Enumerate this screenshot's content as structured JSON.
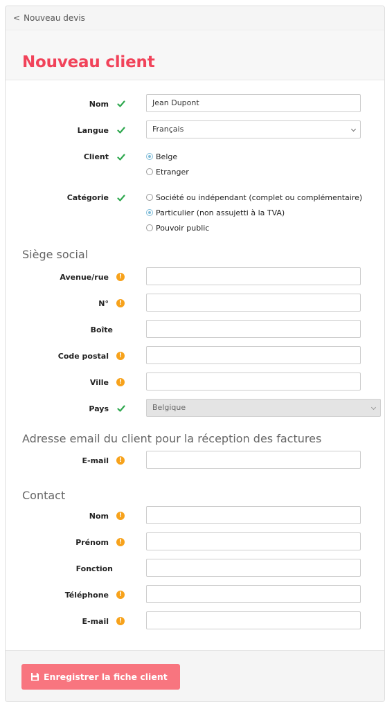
{
  "breadcrumb": {
    "icon": "chevron-left-icon",
    "label": "Nouveau devis"
  },
  "page_title": "Nouveau client",
  "colors": {
    "title": "#f1435a",
    "ok": "#2fa84f",
    "warn": "#f7a21b",
    "save_button": "#f8757f",
    "radio_selected": "#7fbcd8"
  },
  "client": {
    "nom": {
      "label": "Nom",
      "status": "check-icon",
      "value": "Jean Dupont"
    },
    "langue": {
      "label": "Langue",
      "status": "check-icon",
      "value": "Français"
    },
    "type": {
      "label": "Client",
      "status": "check-icon",
      "options": [
        "Belge",
        "Etranger"
      ],
      "selected": "Belge"
    },
    "categorie": {
      "label": "Catégorie",
      "status": "check-icon",
      "options": [
        "Société ou indépendant (complet ou complémentaire)",
        "Particulier (non assujetti à la TVA)",
        "Pouvoir public"
      ],
      "selected": "Particulier (non assujetti à la TVA)"
    }
  },
  "siege": {
    "title": "Siège social",
    "fields": {
      "avenue": {
        "label": "Avenue/rue",
        "status": "warning-icon",
        "value": ""
      },
      "numero": {
        "label": "N°",
        "status": "warning-icon",
        "value": ""
      },
      "boite": {
        "label": "Boîte",
        "value": ""
      },
      "code_postal": {
        "label": "Code postal",
        "status": "warning-icon",
        "value": ""
      },
      "ville": {
        "label": "Ville",
        "status": "warning-icon",
        "value": ""
      },
      "pays": {
        "label": "Pays",
        "status": "check-icon",
        "value": "Belgique"
      }
    }
  },
  "facturation": {
    "title": "Adresse email du client pour la réception des factures",
    "email": {
      "label": "E-mail",
      "status": "warning-icon",
      "value": ""
    }
  },
  "contact": {
    "title": "Contact",
    "fields": {
      "nom": {
        "label": "Nom",
        "status": "warning-icon",
        "value": ""
      },
      "prenom": {
        "label": "Prénom",
        "status": "warning-icon",
        "value": ""
      },
      "fonction": {
        "label": "Fonction",
        "value": ""
      },
      "telephone": {
        "label": "Téléphone",
        "status": "warning-icon",
        "value": ""
      },
      "email": {
        "label": "E-mail",
        "status": "warning-icon",
        "value": ""
      }
    }
  },
  "warn_glyph": "!",
  "save_button": {
    "icon": "save-icon",
    "label": "Enregistrer la fiche client"
  }
}
